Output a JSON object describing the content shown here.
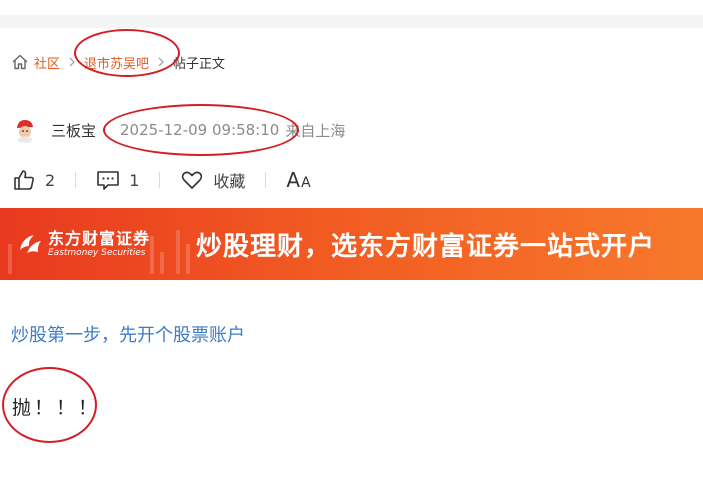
{
  "breadcrumb": {
    "community": "社区",
    "bar": "退市苏吴吧",
    "current": "帖子正文"
  },
  "author": {
    "name": "三板宝",
    "time": "2025-12-09 09:58:10",
    "location": "来自上海"
  },
  "actions": {
    "likes": "2",
    "comments": "1",
    "favorite_label": "收藏",
    "font_big": "A",
    "font_small": "A"
  },
  "banner": {
    "logo_cn": "东方财富证券",
    "logo_en": "Eastmoney Securities",
    "slogan": "炒股理财，选东方财富证券一站式开户"
  },
  "ad_link": "炒股第一步，先开个股票账户",
  "post": {
    "content": "抛！！！"
  },
  "colors": {
    "link_orange": "#e35a1e",
    "link_blue": "#3d7cc9",
    "annotation_red": "#d21f26",
    "banner_orange": "#f15a22"
  }
}
